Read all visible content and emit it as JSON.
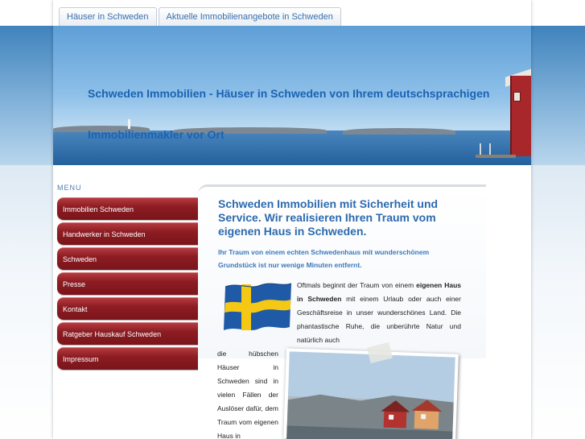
{
  "nav": {
    "tabs": [
      {
        "label": "Häuser in Schweden"
      },
      {
        "label": "Aktuelle Immobilienangebote in Schweden"
      }
    ]
  },
  "header": {
    "title": "Schweden Immobilien - Häuser in Schweden von Ihrem deutschsprachigen Immobilienmakler vor Ort"
  },
  "menu": {
    "label": "MENU",
    "items": [
      {
        "label": "Immobilien Schweden"
      },
      {
        "label": "Handwerker in Schweden"
      },
      {
        "label": "Schweden"
      },
      {
        "label": "Presse"
      },
      {
        "label": "Kontakt"
      },
      {
        "label": "Ratgeber Hauskauf Schweden"
      },
      {
        "label": "Impressum"
      }
    ]
  },
  "content": {
    "title": "Schweden Immobilien mit Sicherheit und Service. Wir realisieren Ihren Traum vom eigenen Haus in Schweden.",
    "subtitle": "Ihr Traum von einem echten Schwedenhaus mit wunderschönem Grundstück ist nur wenige Minuten entfernt.",
    "para_intro": "Oftmals beginnt der Traum von einem ",
    "para_bold": "eigenen Haus in Schweden",
    "para_rest": " mit einem Urlaub oder auch einer Geschäftsreise in unser wunderschönes Land. Die phantastische Ruhe, die unberührte Natur und natürlich auch",
    "para_left": "die hübschen Häuser in Schweden sind in vielen Fällen der Auslöser dafür, dem Traum vom eigenen Haus in"
  },
  "colors": {
    "accent_blue": "#2c6aaf",
    "menu_red": "#8c1c22",
    "flag_blue": "#1f5aa6",
    "flag_yellow": "#f4c815"
  },
  "icons": {
    "flag": "swedish-flag",
    "photo": "coastal-houses-photo"
  }
}
